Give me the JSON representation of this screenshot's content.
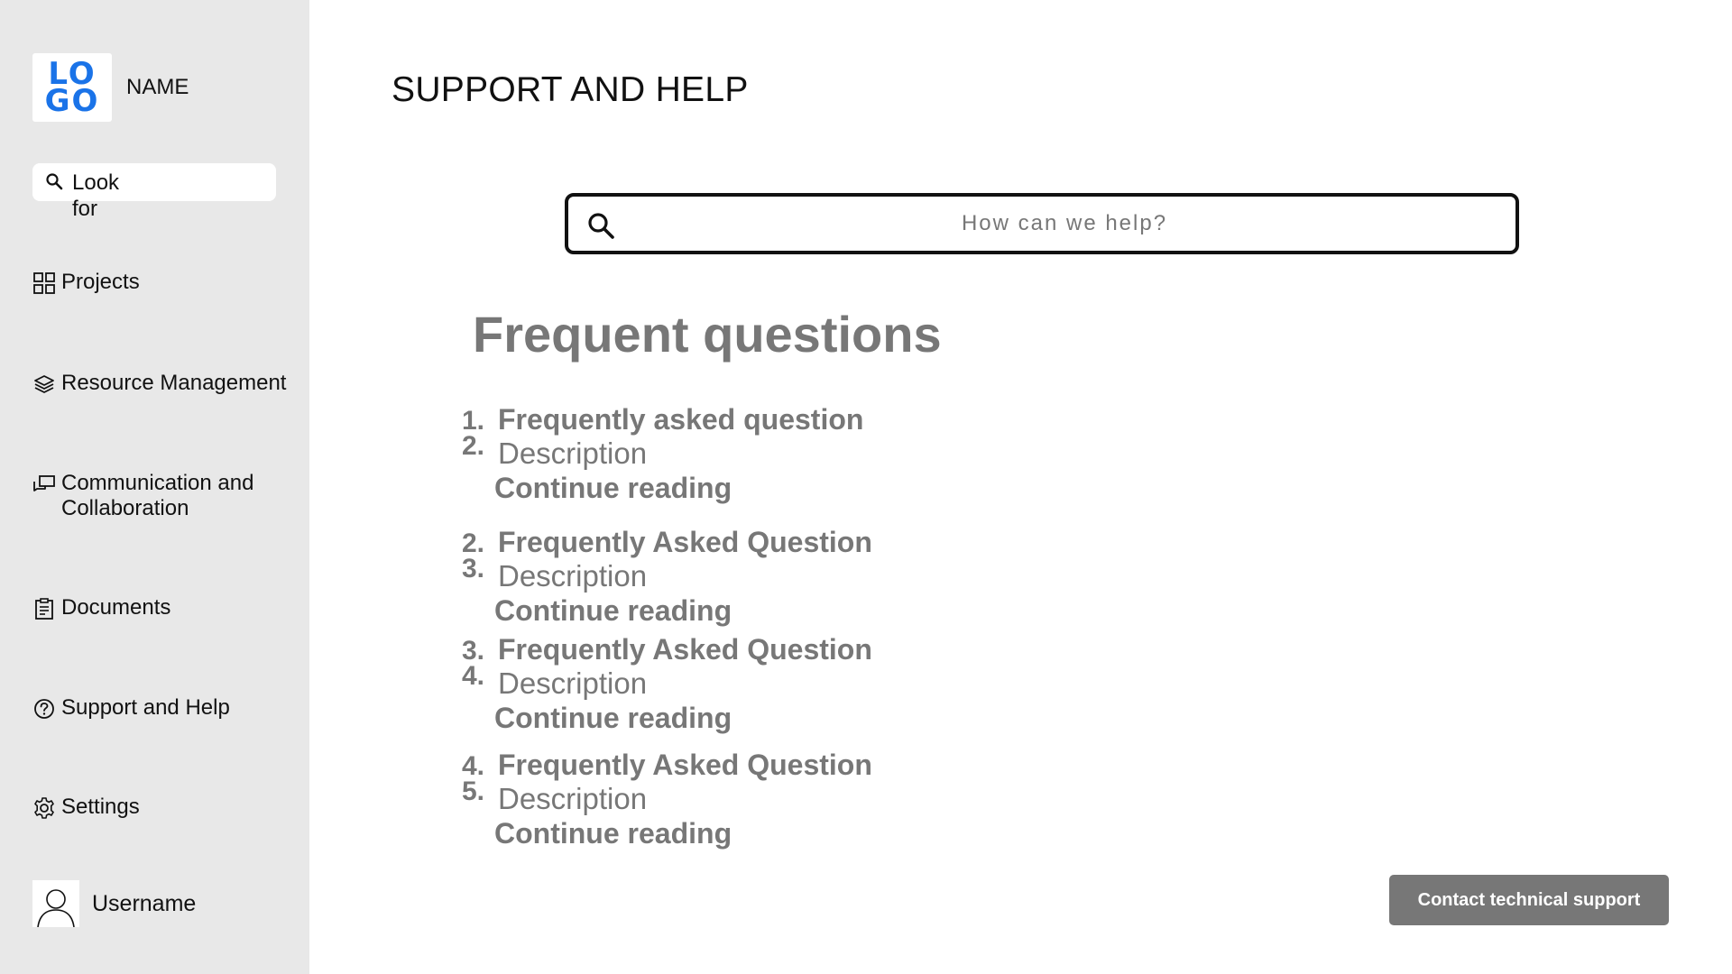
{
  "brand": {
    "logo_text": "LO GO",
    "name": "NAME",
    "accent_color": "#1a73e8"
  },
  "sidebar": {
    "search_label": "Look for",
    "items": [
      {
        "label": "Projects",
        "icon": "grid-icon"
      },
      {
        "label": "Resource Management",
        "icon": "layers-icon"
      },
      {
        "label": "Communication and Collaboration",
        "icon": "chat-icon"
      },
      {
        "label": "Documents",
        "icon": "clipboard-icon"
      },
      {
        "label": "Support and Help",
        "icon": "help-circle-icon"
      },
      {
        "label": "Settings",
        "icon": "gear-icon"
      }
    ],
    "user": {
      "label": "Username",
      "icon": "user-avatar-icon"
    }
  },
  "main": {
    "title": "SUPPORT AND HELP",
    "search_placeholder": "How can we help?",
    "faq_heading": "Frequent questions",
    "faqs": [
      {
        "q_num": "1.",
        "question": "Frequently asked question",
        "d_num": "2.",
        "description": "Description",
        "more": "Continue reading"
      },
      {
        "q_num": "2.",
        "question": "Frequently Asked Question",
        "d_num": "3.",
        "description": "Description",
        "more": "Continue reading"
      },
      {
        "q_num": "3.",
        "question": "Frequently Asked Question",
        "d_num": "4.",
        "description": "Description",
        "more": "Continue reading"
      },
      {
        "q_num": "4.",
        "question": "Frequently Asked Question",
        "d_num": "5.",
        "description": "Description",
        "more": "Continue reading"
      }
    ],
    "contact_button": "Contact technical support"
  },
  "colors": {
    "sidebar_bg": "#e8e8e8",
    "muted_text": "#777777",
    "button_bg": "#777777"
  }
}
